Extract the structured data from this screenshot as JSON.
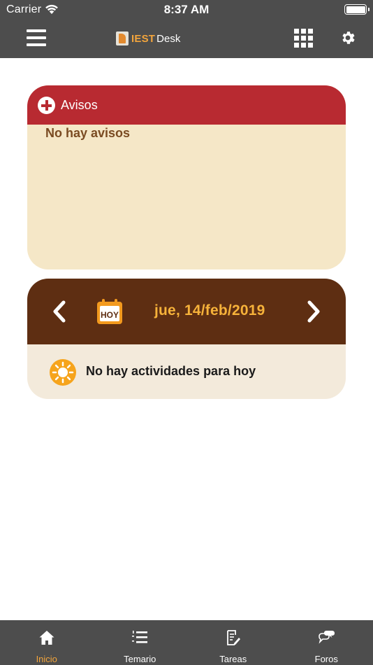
{
  "status_bar": {
    "carrier": "Carrier",
    "time": "8:37 AM"
  },
  "header": {
    "logo_iest": "IEST",
    "logo_desk": "Desk"
  },
  "avisos": {
    "title": "Avisos",
    "empty_message": "No hay avisos"
  },
  "calendar": {
    "icon_text": "HOY",
    "date": "jue, 14/feb/2019",
    "empty_message": "No hay actividades para hoy"
  },
  "tabs": [
    {
      "label": "Inicio",
      "icon": "home-icon",
      "active": true
    },
    {
      "label": "Temario",
      "icon": "numbered-list-icon",
      "active": false
    },
    {
      "label": "Tareas",
      "icon": "document-edit-icon",
      "active": false
    },
    {
      "label": "Foros",
      "icon": "chat-bubbles-icon",
      "active": false
    }
  ],
  "colors": {
    "bar": "#4d4d4d",
    "accent_orange": "#f3a53c",
    "avisos_header": "#b82a31",
    "avisos_body": "#f5e7c7",
    "calendar_header": "#5e2e12",
    "calendar_body": "#f3eadb"
  }
}
